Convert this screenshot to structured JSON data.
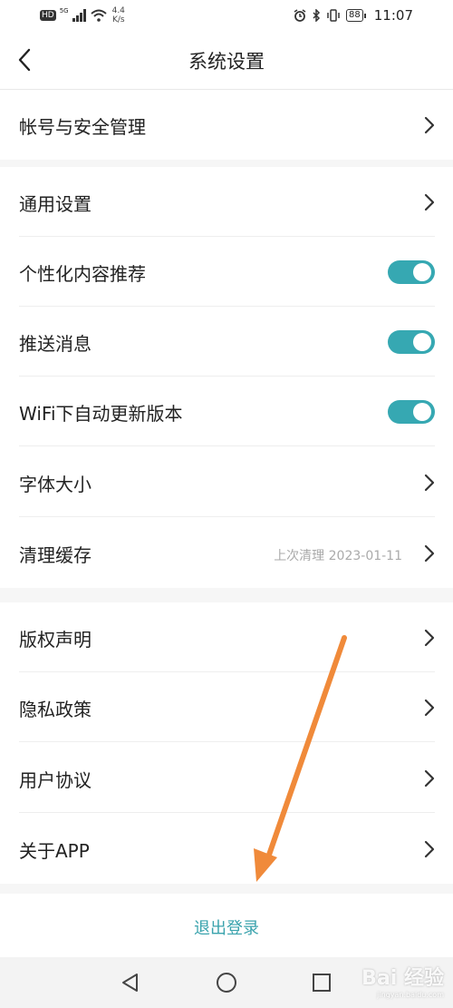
{
  "status_bar": {
    "hd": "HD",
    "signal": "5G",
    "speed_value": "4.4",
    "speed_unit": "K/s",
    "battery": "88",
    "time": "11:07"
  },
  "header": {
    "title": "系统设置"
  },
  "sections": [
    {
      "rows": [
        {
          "label": "帐号与安全管理",
          "type": "link"
        }
      ]
    },
    {
      "rows": [
        {
          "label": "通用设置",
          "type": "link"
        },
        {
          "label": "个性化内容推荐",
          "type": "toggle",
          "on": true
        },
        {
          "label": "推送消息",
          "type": "toggle",
          "on": true
        },
        {
          "label": "WiFi下自动更新版本",
          "type": "toggle",
          "on": true
        },
        {
          "label": "字体大小",
          "type": "link"
        },
        {
          "label": "清理缓存",
          "type": "link",
          "sub": "上次清理  2023-01-11"
        }
      ]
    },
    {
      "rows": [
        {
          "label": "版权声明",
          "type": "link"
        },
        {
          "label": "隐私政策",
          "type": "link"
        },
        {
          "label": "用户协议",
          "type": "link"
        },
        {
          "label": "关于APP",
          "type": "link"
        }
      ]
    }
  ],
  "logout_label": "退出登录",
  "colors": {
    "accent": "#3aa3ad",
    "toggle_on": "#36a8b2",
    "annotation_arrow": "#f08a3a"
  },
  "watermark": {
    "text": "Bai 经验",
    "sub": "jingyan.baidu.com"
  }
}
